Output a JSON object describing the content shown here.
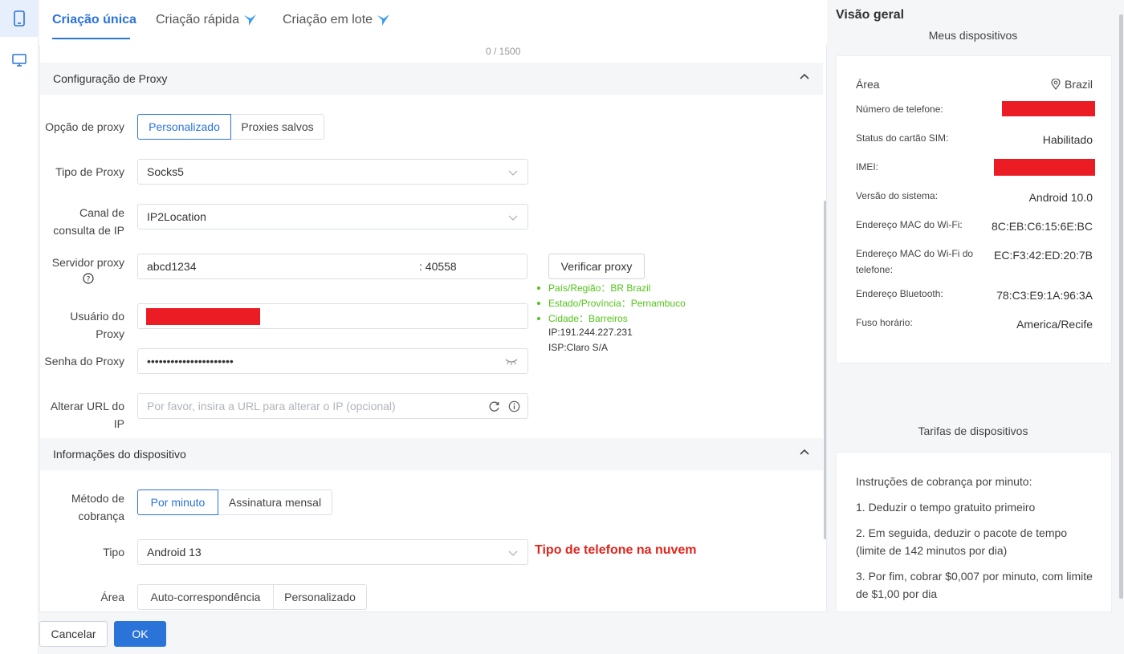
{
  "tabs": [
    {
      "label": "Criação única"
    },
    {
      "label": "Criação rápida"
    },
    {
      "label": "Criação em lote"
    }
  ],
  "counter_text": "0 / 1500",
  "proxy_section": {
    "title": "Configuração de Proxy",
    "option_label": "Opção de proxy",
    "option_buttons": [
      "Personalizado",
      "Proxies salvos"
    ],
    "type_label": "Tipo de Proxy",
    "type_value": "Socks5",
    "channel_label_1": "Canal de",
    "channel_label_2": "consulta de IP",
    "channel_value": "IP2Location",
    "server_label": "Servidor proxy",
    "server_host": "abcd1234",
    "server_port": ": 40558",
    "verify_button": "Verificar proxy",
    "verify_result": {
      "country": "País/Região：BR Brazil",
      "state": "Estado/Província：Pernambuco",
      "city": "Cidade：Barreiros",
      "ip": "IP:191.244.227.231",
      "isp": "ISP:Claro S/A"
    },
    "user_label": "Usuário do Proxy",
    "password_label": "Senha do Proxy",
    "password_value": "••••••••••••••••••••••",
    "change_url_label": "Alterar URL do IP",
    "change_url_placeholder": "Por favor, insira a URL para alterar o IP (opcional)"
  },
  "device_section": {
    "title": "Informações do dispositivo",
    "billing_label_1": "Método de",
    "billing_label_2": "cobrança",
    "billing_buttons": [
      "Por minuto",
      "Assinatura mensal"
    ],
    "type_label": "Tipo",
    "type_value": "Android 13",
    "type_annotation": "Tipo de telefone na nuvem",
    "area_label": "Área",
    "area_buttons": [
      "Auto-correspondência",
      "Personalizado"
    ]
  },
  "footer": {
    "cancel": "Cancelar",
    "ok": "OK"
  },
  "overview": {
    "title": "Visão geral",
    "devices_title": "Meus dispositivos",
    "area_label": "Área",
    "area_value": "Brazil",
    "rows": [
      {
        "label": "Número de telefone:",
        "value": ""
      },
      {
        "label": "Status do cartão SIM:",
        "value": "Habilitado"
      },
      {
        "label": "IMEI:",
        "value": ""
      },
      {
        "label": "Versão do sistema:",
        "value": "Android 10.0"
      },
      {
        "label": "Endereço MAC do Wi-Fi:",
        "value": "8C:EB:C6:15:6E:BC"
      },
      {
        "label": "Endereço MAC do Wi-Fi do telefone:",
        "value": "EC:F3:42:ED:20:7B"
      },
      {
        "label": "Endereço Bluetooth:",
        "value": "78:C3:E9:1A:96:3A"
      },
      {
        "label": "Fuso horário:",
        "value": "America/Recife"
      }
    ],
    "rates_title": "Tarifas de dispositivos",
    "billing_lines": [
      "Instruções de cobrança por minuto:",
      "1. Deduzir o tempo gratuito primeiro",
      "2. Em seguida, deduzir o pacote de tempo (limite de 142 minutos por dia)",
      "3. Por fim, cobrar $0,007 por minuto, com limite de $1,00 por dia"
    ]
  },
  "colors": {
    "accent": "#2a73d9",
    "success": "#52c41a",
    "annotation": "#e0241c"
  }
}
